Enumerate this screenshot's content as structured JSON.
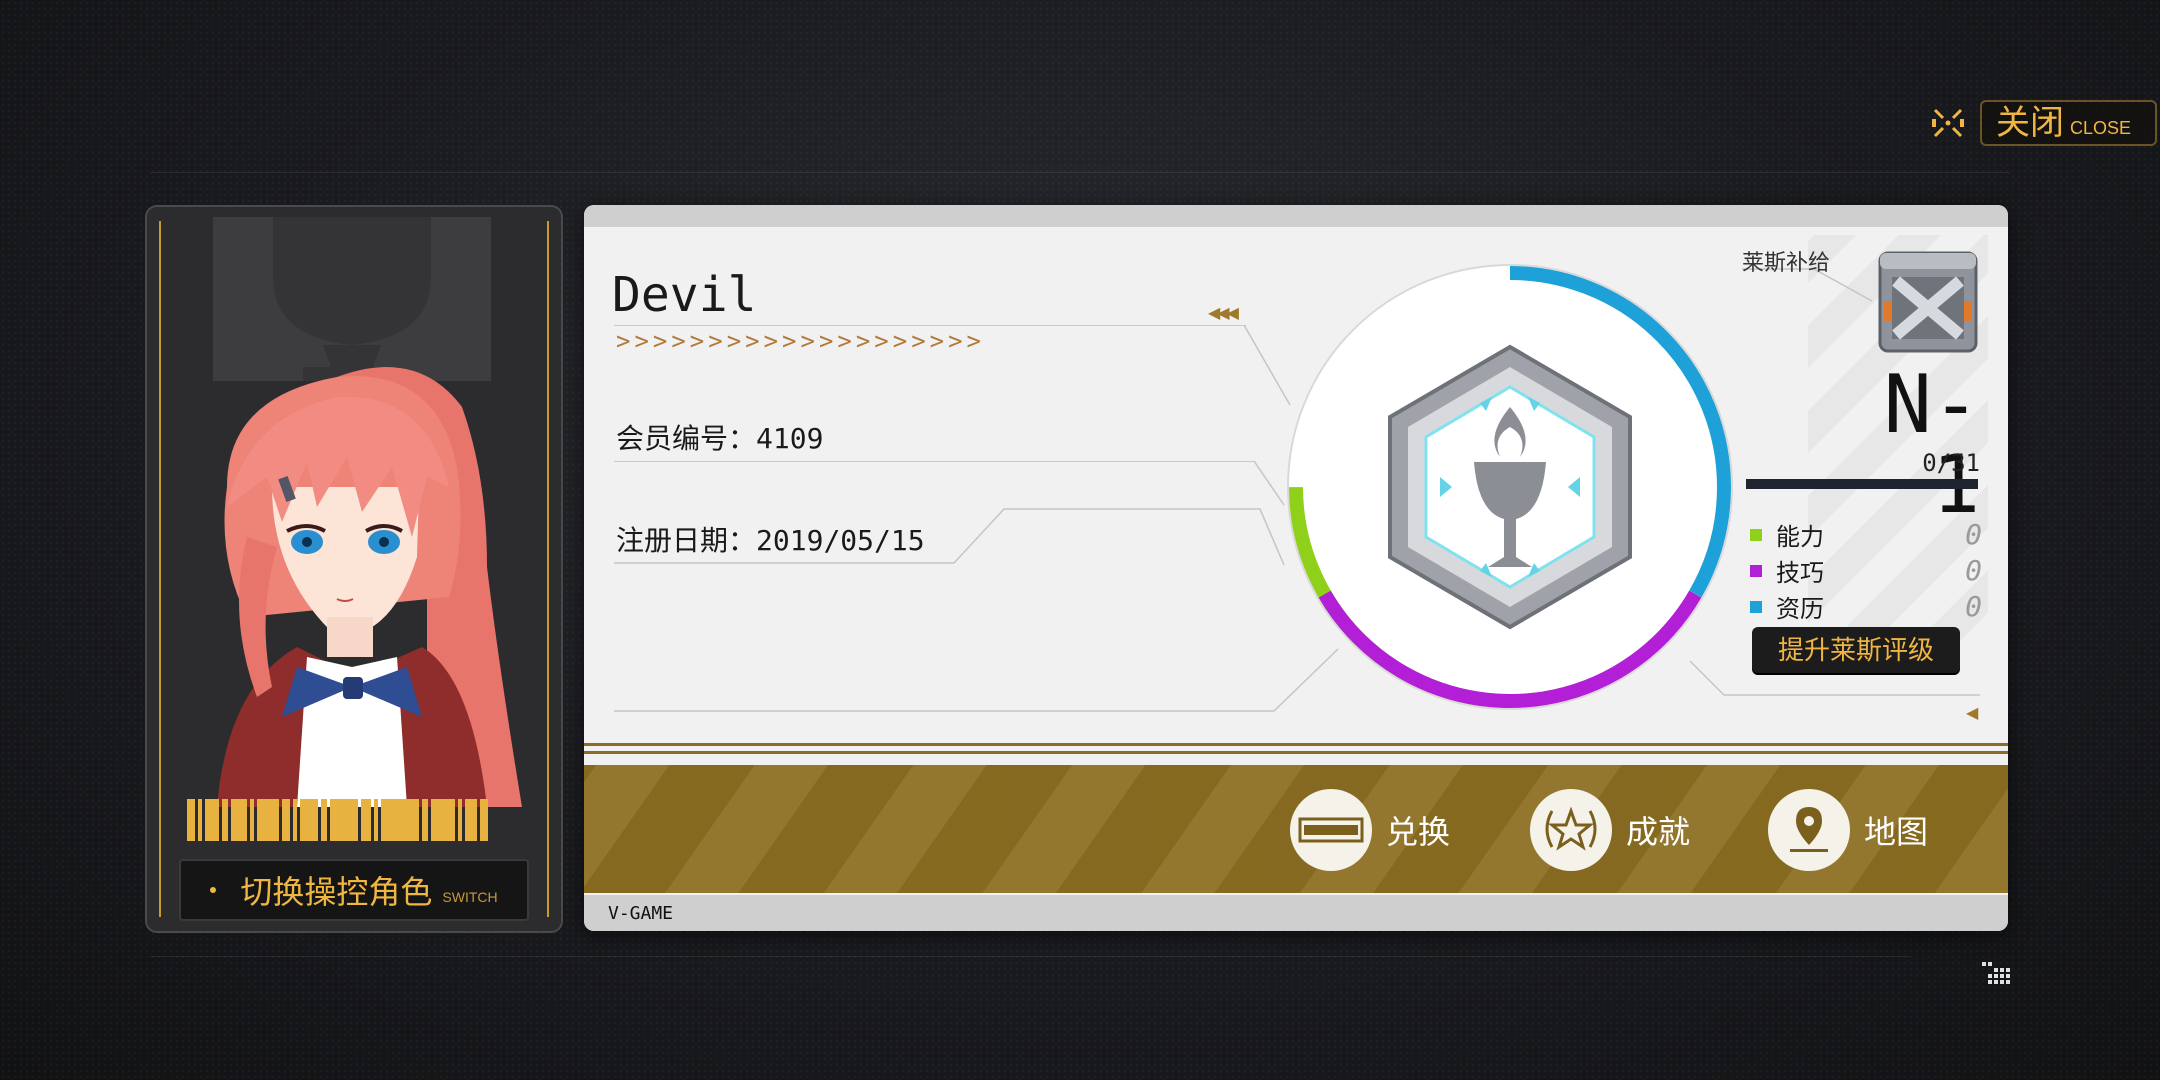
{
  "close": {
    "label_cn": "关闭",
    "label_en": "CLOSE",
    "icon": "close-icon"
  },
  "character": {
    "switch_label_cn": "切换操控角色",
    "switch_label_en": "SWITCH",
    "portrait": "pink-haired-girl-portrait"
  },
  "profile": {
    "name": "Devil",
    "chevrons": ">>>>>>>>>>>>>>>>>>>>",
    "member_label": "会员编号：",
    "member_id": "4109",
    "register_label": "注册日期：",
    "register_date": "2019/05/15"
  },
  "supply": {
    "label": "莱斯补给",
    "icon": "supply-crate-icon"
  },
  "rank": {
    "title": "N-1",
    "progress_text": "0/31",
    "progress": 0.0
  },
  "stats": [
    {
      "name": "能力",
      "value": "0",
      "color": "#8fd11a"
    },
    {
      "name": "技巧",
      "value": "0",
      "color": "#b21fd6"
    },
    {
      "name": "资历",
      "value": "0",
      "color": "#1ea0d8"
    }
  ],
  "upgrade_button": "提升莱斯评级",
  "ring_colors": {
    "green": "#8fd11a",
    "blue": "#1ea0d8",
    "purple": "#b21fd6"
  },
  "actions": [
    {
      "label": "兑换",
      "icon": "ticket-icon"
    },
    {
      "label": "成就",
      "icon": "star-wreath-icon"
    },
    {
      "label": "地图",
      "icon": "map-pin-icon"
    }
  ],
  "footer": "V-GAME",
  "accent": "#f0b642"
}
